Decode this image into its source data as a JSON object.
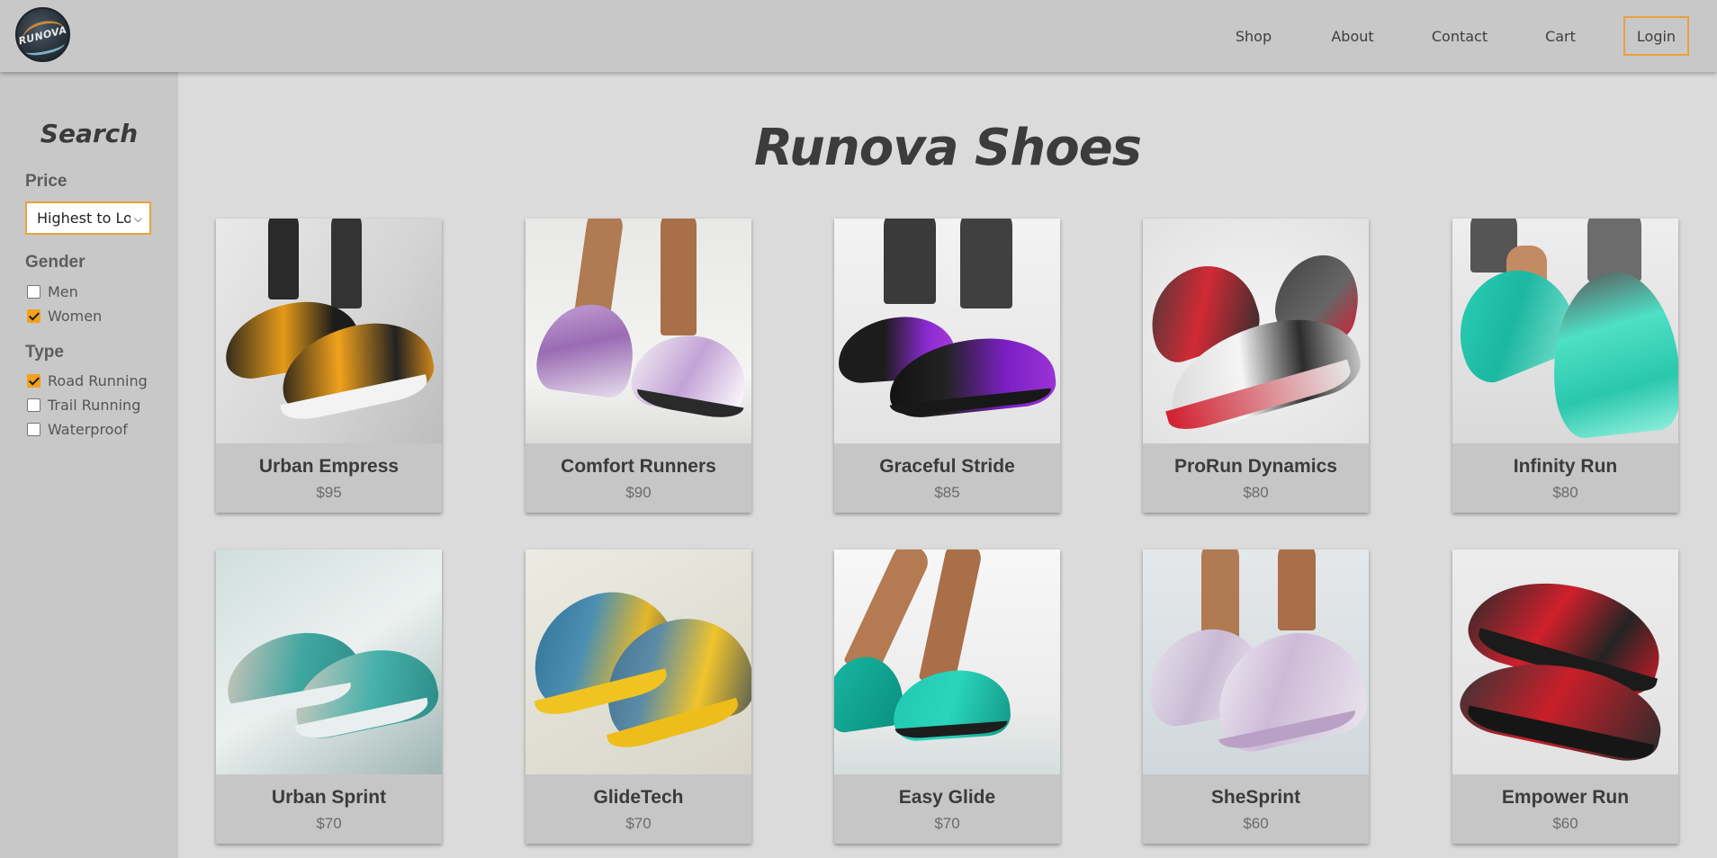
{
  "brand": {
    "logo_text": "RUNOVA"
  },
  "nav": {
    "shop": "Shop",
    "about": "About",
    "contact": "Contact",
    "cart": "Cart",
    "login": "Login"
  },
  "sidebar": {
    "title": "Search",
    "price_label": "Price",
    "price_selected": "Highest to Low",
    "gender_label": "Gender",
    "gender_options": [
      {
        "label": "Men",
        "checked": false
      },
      {
        "label": "Women",
        "checked": true
      }
    ],
    "type_label": "Type",
    "type_options": [
      {
        "label": "Road Running",
        "checked": true
      },
      {
        "label": "Trail Running",
        "checked": false
      },
      {
        "label": "Waterproof",
        "checked": false
      }
    ]
  },
  "main": {
    "title": "Runova Shoes",
    "products": [
      {
        "name": "Urban Empress",
        "price": "$95"
      },
      {
        "name": "Comfort Runners",
        "price": "$90"
      },
      {
        "name": "Graceful Stride",
        "price": "$85"
      },
      {
        "name": "ProRun Dynamics",
        "price": "$80"
      },
      {
        "name": "Infinity Run",
        "price": "$80"
      },
      {
        "name": "Urban Sprint",
        "price": "$70"
      },
      {
        "name": "GlideTech",
        "price": "$70"
      },
      {
        "name": "Easy Glide",
        "price": "$70"
      },
      {
        "name": "SheSprint",
        "price": "$60"
      },
      {
        "name": "Empower Run",
        "price": "$60"
      }
    ]
  },
  "colors": {
    "accent": "#e8a33a",
    "checkbox": "#f2a11c",
    "header_bg": "#c9c8c9",
    "page_bg": "#dcdbdc"
  }
}
